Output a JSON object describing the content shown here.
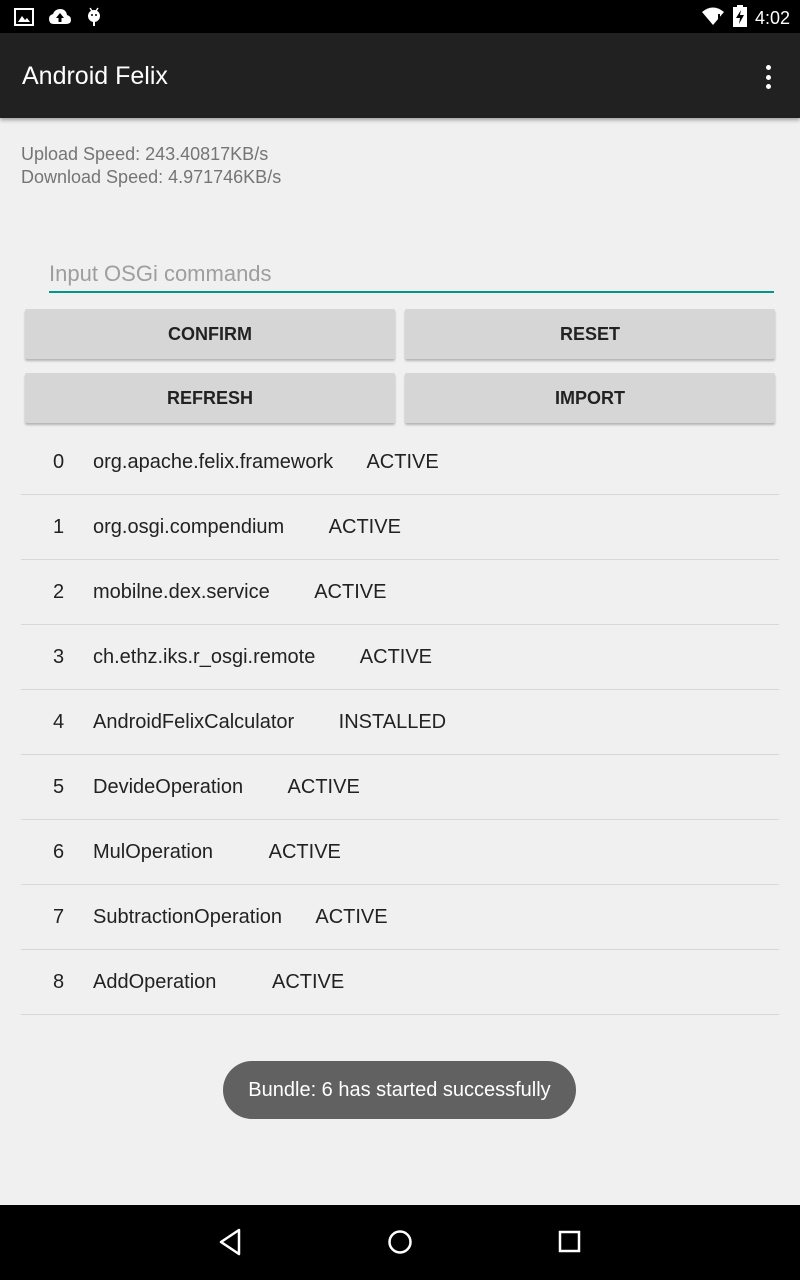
{
  "status_bar": {
    "time": "4:02",
    "icons_left": [
      "image-icon",
      "cloud-upload-icon",
      "android-debug-icon"
    ],
    "icons_right": [
      "wifi-icon",
      "battery-charging-icon"
    ]
  },
  "app_bar": {
    "title": "Android Felix",
    "menu_icon": "overflow-menu-icon"
  },
  "speed": {
    "upload": "Upload Speed: 243.40817KB/s",
    "download": "Download Speed: 4.971746KB/s"
  },
  "command_input": {
    "placeholder": "Input OSGi commands",
    "value": ""
  },
  "buttons": {
    "confirm": "CONFIRM",
    "reset": "RESET",
    "refresh": "REFRESH",
    "import": "IMPORT"
  },
  "bundles": [
    {
      "id": "0",
      "name": "org.apache.felix.framework",
      "state": "ACTIVE"
    },
    {
      "id": "1",
      "name": "org.osgi.compendium",
      "state": "ACTIVE"
    },
    {
      "id": "2",
      "name": "mobilne.dex.service",
      "state": "ACTIVE"
    },
    {
      "id": "3",
      "name": "ch.ethz.iks.r_osgi.remote",
      "state": "ACTIVE"
    },
    {
      "id": "4",
      "name": "AndroidFelixCalculator",
      "state": "INSTALLED"
    },
    {
      "id": "5",
      "name": "DevideOperation",
      "state": "ACTIVE"
    },
    {
      "id": "6",
      "name": "MulOperation",
      "state": "ACTIVE"
    },
    {
      "id": "7",
      "name": "SubtractionOperation",
      "state": "ACTIVE"
    },
    {
      "id": "8",
      "name": "AddOperation",
      "state": "ACTIVE"
    }
  ],
  "toast": "Bundle: 6 has started successfully",
  "nav_bar": [
    "back-icon",
    "home-icon",
    "recents-icon"
  ],
  "colors": {
    "app_bar": "#212121",
    "accent": "#009688",
    "background": "#f0f0f0",
    "button": "#d6d6d6",
    "toast": "#616161"
  }
}
